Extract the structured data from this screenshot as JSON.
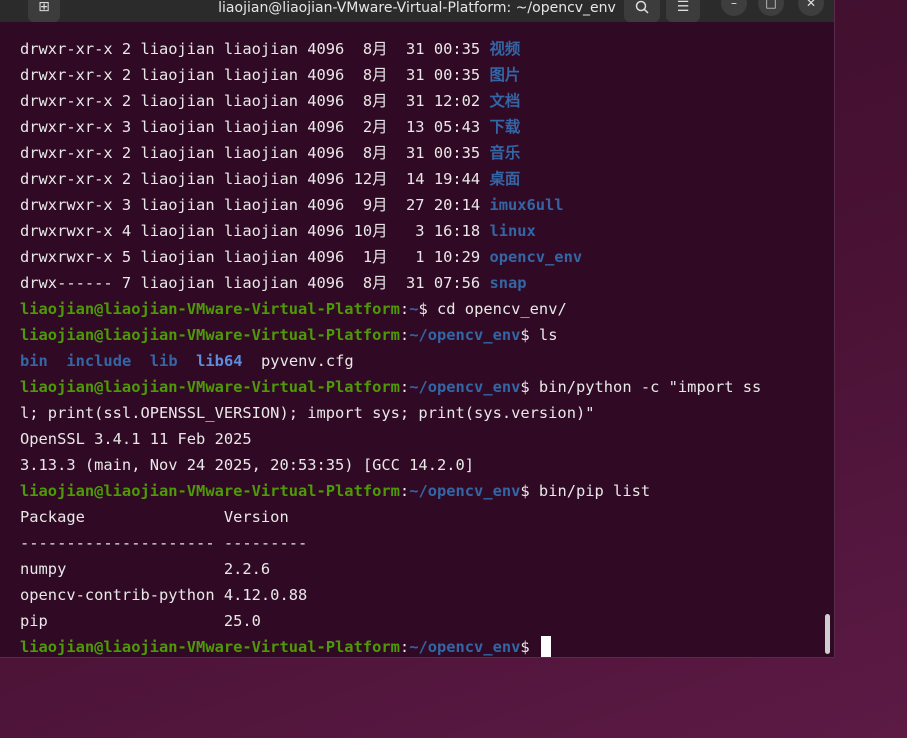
{
  "window": {
    "title": "liaojian@liaojian-VMware-Virtual-Platform: ~/opencv_env",
    "new_tab_icon": "new-tab-icon",
    "search_icon": "search-icon",
    "menu_icon": "hamburger-menu-icon",
    "minimize_icon": "minimize-icon",
    "maximize_icon": "maximize-icon",
    "close_icon": "close-icon"
  },
  "listing": [
    {
      "perm": "drwxr-xr-x 2 liaojian liaojian 4096  8月  31 00:35 ",
      "name": "视频"
    },
    {
      "perm": "drwxr-xr-x 2 liaojian liaojian 4096  8月  31 00:35 ",
      "name": "图片"
    },
    {
      "perm": "drwxr-xr-x 2 liaojian liaojian 4096  8月  31 12:02 ",
      "name": "文档"
    },
    {
      "perm": "drwxr-xr-x 3 liaojian liaojian 4096  2月  13 05:43 ",
      "name": "下载"
    },
    {
      "perm": "drwxr-xr-x 2 liaojian liaojian 4096  8月  31 00:35 ",
      "name": "音乐"
    },
    {
      "perm": "drwxr-xr-x 2 liaojian liaojian 4096 12月  14 19:44 ",
      "name": "桌面"
    },
    {
      "perm": "drwxrwxr-x 3 liaojian liaojian 4096  9月  27 20:14 ",
      "name": "imux6ull"
    },
    {
      "perm": "drwxrwxr-x 4 liaojian liaojian 4096 10月   3 16:18 ",
      "name": "linux"
    },
    {
      "perm": "drwxrwxr-x 5 liaojian liaojian 4096  1月   1 10:29 ",
      "name": "opencv_env"
    },
    {
      "perm": "drwx------ 7 liaojian liaojian 4096  8月  31 07:56 ",
      "name": "snap"
    }
  ],
  "prompt_user": "liaojian@liaojian-VMware-Virtual-Platform",
  "cmd1": {
    "path": "~",
    "command": "$ cd opencv_env/"
  },
  "cmd2": {
    "path": "~/opencv_env",
    "command": "$ ls"
  },
  "ls_out": {
    "bin": "bin",
    "include": "include",
    "lib": "lib",
    "lib64": "lib64",
    "pyvenv": "pyvenv.cfg"
  },
  "cmd3": {
    "path": "~/opencv_env",
    "command": "$ bin/python -c \"import ss",
    "wrap": "l; print(ssl.OPENSSL_VERSION); import sys; print(sys.version)\""
  },
  "out3": {
    "line1": "OpenSSL 3.4.1 11 Feb 2025",
    "line2": "3.13.3 (main, Nov 24 2025, 20:53:35) [GCC 14.2.0]"
  },
  "cmd4": {
    "path": "~/opencv_env",
    "command": "$ bin/pip list"
  },
  "pip_table": {
    "header": "Package               Version",
    "rule": "--------------------- ---------",
    "rows": [
      "numpy                 2.2.6",
      "opencv-contrib-python 4.12.0.88",
      "pip                   25.0"
    ]
  },
  "cmd5": {
    "path": "~/opencv_env",
    "command": "$ "
  }
}
